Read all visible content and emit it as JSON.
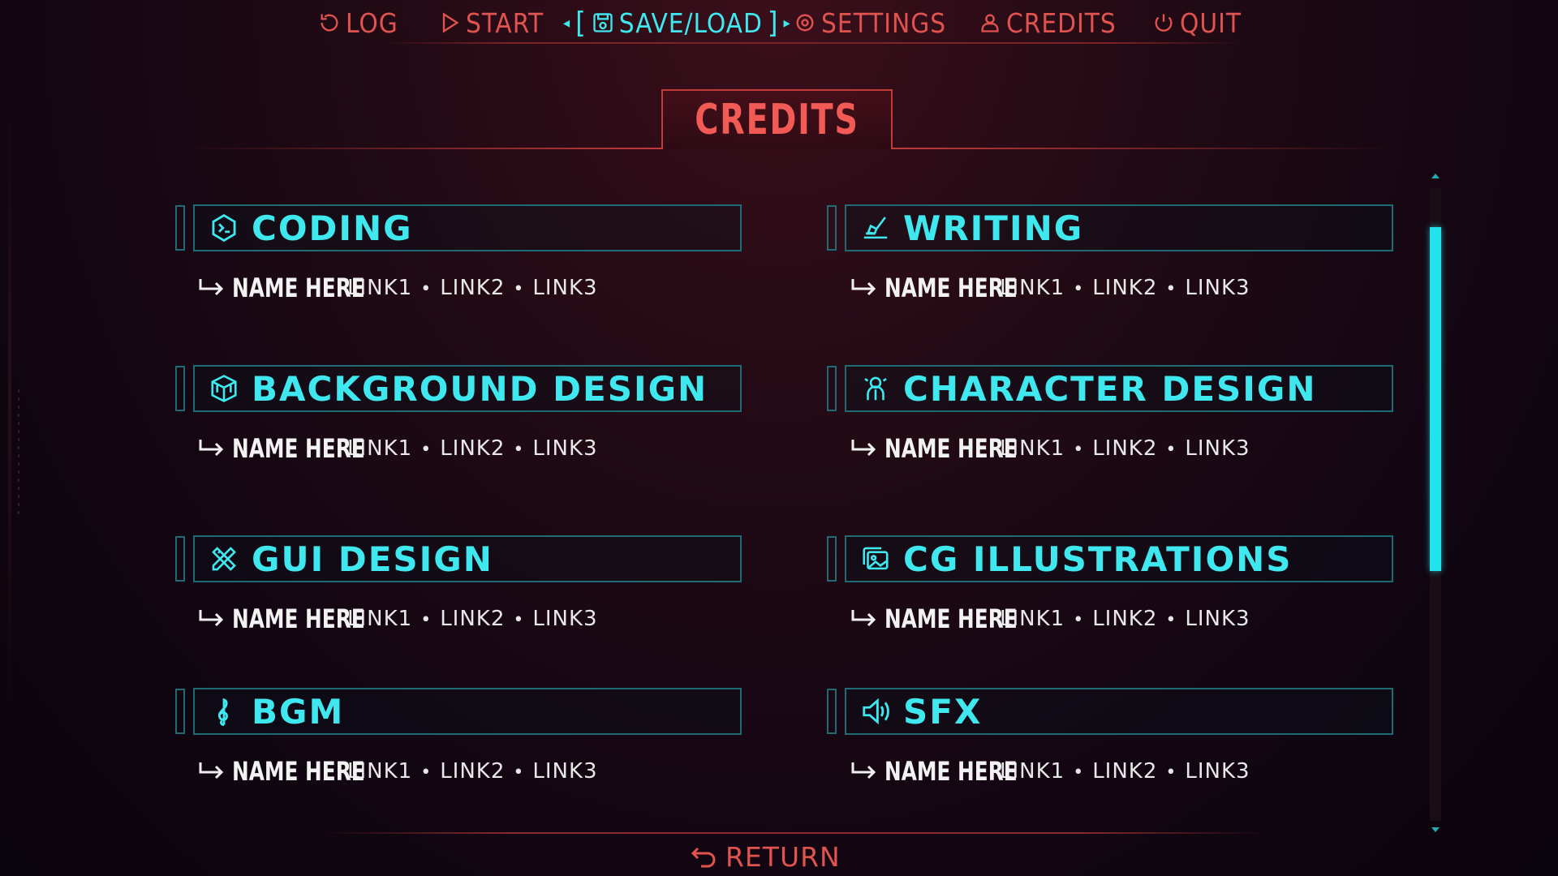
{
  "nav": {
    "items": [
      {
        "label": "LOG",
        "icon": "log-icon"
      },
      {
        "label": "START",
        "icon": "play-icon"
      },
      {
        "label": "SAVE/LOAD",
        "icon": "save-icon",
        "active": true
      },
      {
        "label": "SETTINGS",
        "icon": "settings-icon"
      },
      {
        "label": "CREDITS",
        "icon": "user-icon"
      },
      {
        "label": "QUIT",
        "icon": "power-icon"
      }
    ]
  },
  "page": {
    "title": "CREDITS"
  },
  "sections": [
    {
      "title": "CODING",
      "icon": "code-hexagon-icon",
      "entry": {
        "name": "NAME HERE",
        "links": [
          "LINK1",
          "LINK2",
          "LINK3"
        ]
      }
    },
    {
      "title": "WRITING",
      "icon": "writing-hand-icon",
      "entry": {
        "name": "NAME HERE",
        "links": [
          "LINK1",
          "LINK2",
          "LINK3"
        ]
      }
    },
    {
      "title": "BACKGROUND DESIGN",
      "icon": "cube-icon",
      "entry": {
        "name": "NAME HERE",
        "links": [
          "LINK1",
          "LINK2",
          "LINK3"
        ]
      }
    },
    {
      "title": "CHARACTER DESIGN",
      "icon": "character-icon",
      "entry": {
        "name": "NAME HERE",
        "links": [
          "LINK1",
          "LINK2",
          "LINK3"
        ]
      }
    },
    {
      "title": "GUI DESIGN",
      "icon": "pencil-ruler-icon",
      "entry": {
        "name": "NAME HERE",
        "links": [
          "LINK1",
          "LINK2",
          "LINK3"
        ]
      }
    },
    {
      "title": "CG ILLUSTRATIONS",
      "icon": "image-gallery-icon",
      "entry": {
        "name": "NAME HERE",
        "links": [
          "LINK1",
          "LINK2",
          "LINK3"
        ]
      }
    },
    {
      "title": "BGM",
      "icon": "treble-clef-icon",
      "entry": {
        "name": "NAME HERE",
        "links": [
          "LINK1",
          "LINK2",
          "LINK3"
        ]
      }
    },
    {
      "title": "SFX",
      "icon": "speaker-icon",
      "entry": {
        "name": "NAME HERE",
        "links": [
          "LINK1",
          "LINK2",
          "LINK3"
        ]
      }
    }
  ],
  "footer": {
    "return_label": "RETURN",
    "icon": "return-arrow-icon"
  },
  "colors": {
    "accent_red": "#e0534e",
    "accent_cyan": "#3ee8ee",
    "box_border": "#1e6b75"
  }
}
